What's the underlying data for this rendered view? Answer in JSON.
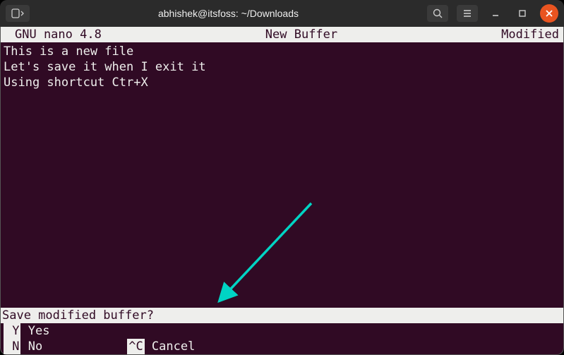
{
  "titlebar": {
    "title": "abhishek@itsfoss: ~/Downloads"
  },
  "nano": {
    "header": {
      "version": "GNU nano 4.8",
      "buffer": "New Buffer",
      "status": "Modified"
    },
    "content": "This is a new file\nLet's save it when I exit it\nUsing shortcut Ctr+X",
    "prompt": "Save modified buffer?",
    "options": {
      "yes_key": " Y",
      "yes_label": " Yes",
      "no_key": " N",
      "no_label": " No",
      "cancel_key": "^C",
      "cancel_label": " Cancel"
    }
  }
}
